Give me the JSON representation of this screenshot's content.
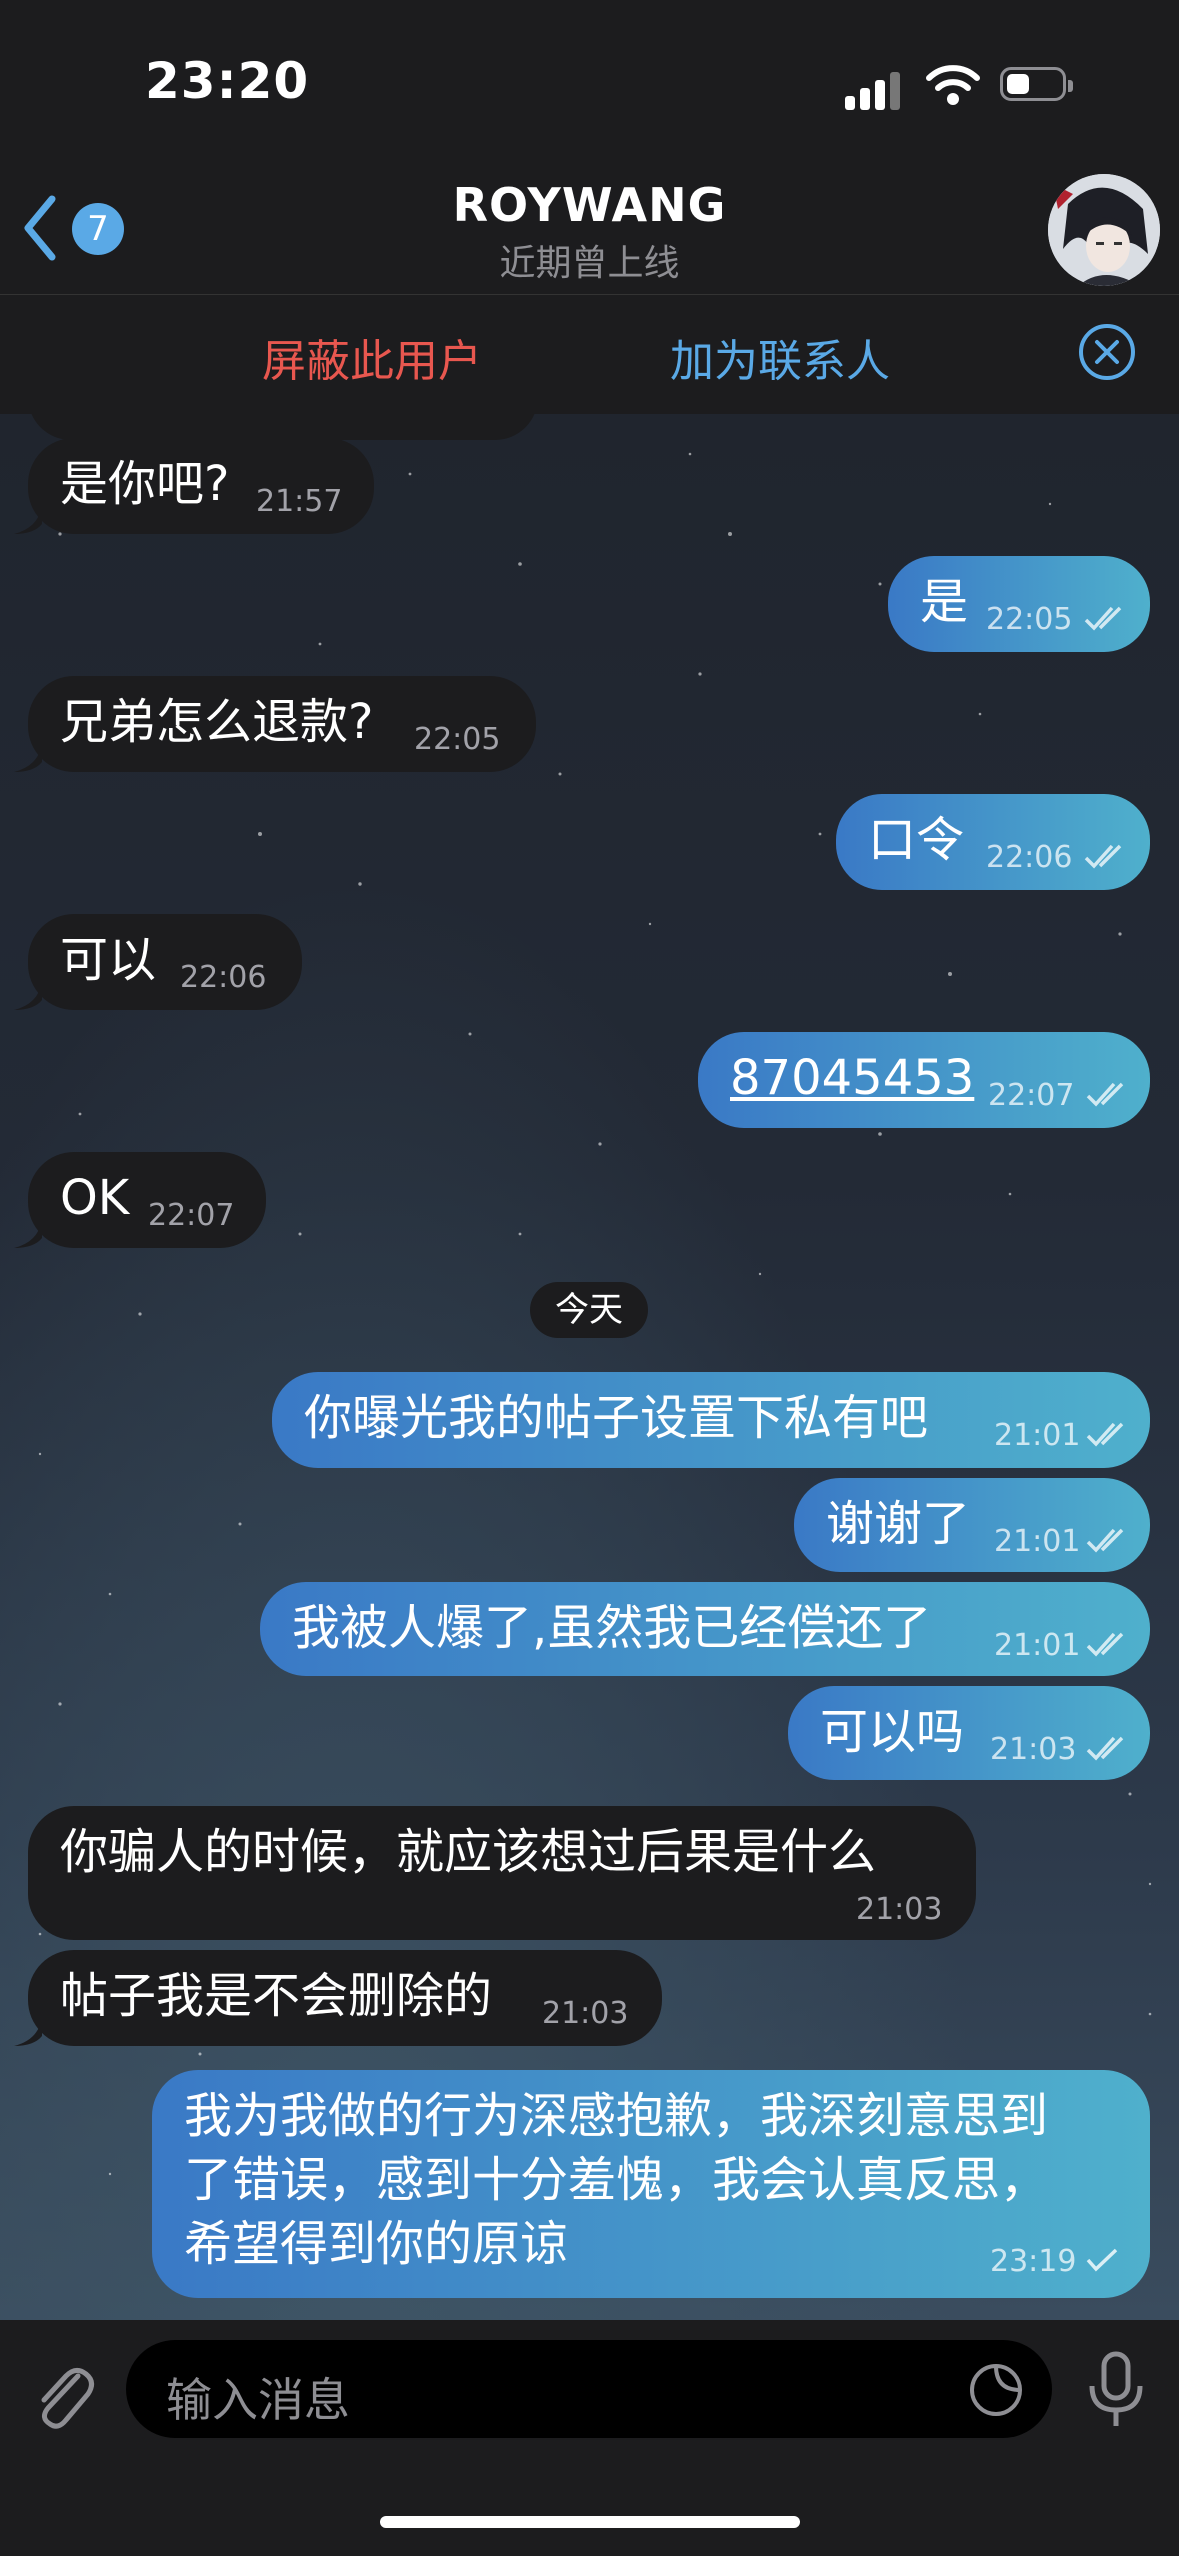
{
  "status_bar": {
    "time": "23:20"
  },
  "nav": {
    "back_badge": "7",
    "title": "ROYWANG",
    "subtitle": "近期曾上线"
  },
  "action_bar": {
    "block_label": "屏蔽此用户",
    "add_contact_label": "加为联系人"
  },
  "messages": [
    {
      "dir": "in",
      "text": "是你吧?",
      "time": "21:57"
    },
    {
      "dir": "out",
      "text": "是",
      "time": "22:05",
      "status": "read"
    },
    {
      "dir": "in",
      "text": "兄弟怎么退款?",
      "time": "22:05"
    },
    {
      "dir": "out",
      "text": "口令",
      "time": "22:06",
      "status": "read"
    },
    {
      "dir": "in",
      "text": "可以",
      "time": "22:06"
    },
    {
      "dir": "out",
      "text": "87045453",
      "time": "22:07",
      "status": "read"
    },
    {
      "dir": "in",
      "text": "OK",
      "time": "22:07"
    },
    {
      "dir": "out",
      "text": "你曝光我的帖子设置下私有吧",
      "time": "21:01",
      "status": "read"
    },
    {
      "dir": "out",
      "text": "谢谢了",
      "time": "21:01",
      "status": "read"
    },
    {
      "dir": "out",
      "text": "我被人爆了,虽然我已经偿还了",
      "time": "21:01",
      "status": "read"
    },
    {
      "dir": "out",
      "text": "可以吗",
      "time": "21:03",
      "status": "read"
    },
    {
      "dir": "in",
      "text": "你骗人的时候，就应该想过后果是什么",
      "time": "21:03"
    },
    {
      "dir": "in",
      "text": "帖子我是不会删除的",
      "time": "21:03"
    },
    {
      "dir": "out",
      "lines": [
        "我为我做的行为深感抱歉，我深刻意思到",
        "了错误，感到十分羞愧，我会认真反思，",
        "希望得到你的原谅"
      ],
      "time": "23:19",
      "status": "sent"
    }
  ],
  "date_separator": "今天",
  "input": {
    "placeholder": "输入消息"
  },
  "colors": {
    "accent": "#5aa9e6",
    "danger": "#e8574f",
    "incoming_bubble": "#1c1c1e",
    "outgoing_start": "#3a79c6",
    "outgoing_end": "#4fb0cc"
  }
}
